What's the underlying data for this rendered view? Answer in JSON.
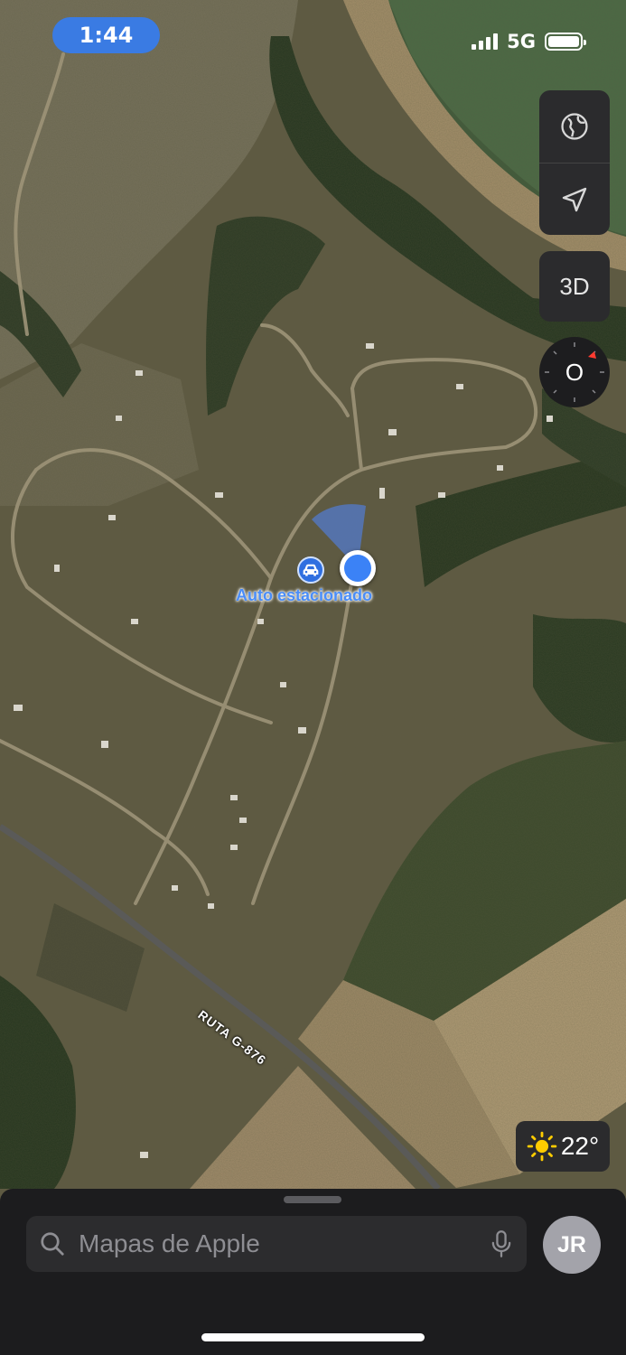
{
  "status_bar": {
    "time": "1:44",
    "network": "5G",
    "signal_bars": 4,
    "battery_level": 1.0
  },
  "map": {
    "parked_car_label": "Auto estacionado",
    "road_label": "RUTA G-876",
    "colors": {
      "user_location": "#3b82f6",
      "parked_car": "#2f6fe0",
      "label": "#4a8df8"
    }
  },
  "controls": {
    "globe_icon": "globe-icon",
    "location_icon": "location-arrow-icon",
    "three_d_label": "3D",
    "compass_label": "O"
  },
  "weather": {
    "icon": "sun-icon",
    "temperature": "22°"
  },
  "search": {
    "placeholder": "Mapas de Apple",
    "value": ""
  },
  "avatar": {
    "initials": "JR"
  }
}
